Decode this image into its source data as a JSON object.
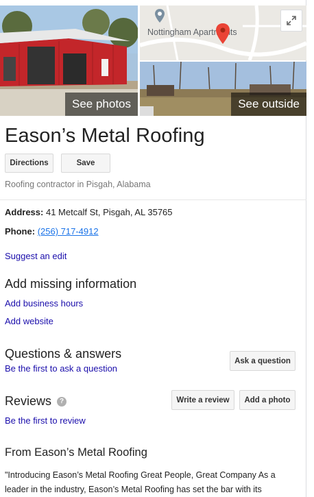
{
  "media": {
    "see_photos": "See photos",
    "see_outside": "See outside",
    "map_label": "Nottingham Apartments"
  },
  "business": {
    "name": "Eason’s Metal Roofing",
    "category": "Roofing contractor in Pisgah, Alabama"
  },
  "actions": {
    "directions": "Directions",
    "save": "Save"
  },
  "details": {
    "address_label": "Address:",
    "address": "41 Metcalf St, Pisgah, AL 35765",
    "phone_label": "Phone:",
    "phone": "(256) 717-4912"
  },
  "links": {
    "suggest_edit": "Suggest an edit",
    "add_hours": "Add business hours",
    "add_website": "Add website",
    "first_ask": "Be the first to ask a question",
    "first_review": "Be the first to review"
  },
  "sections": {
    "missing_info": "Add missing information",
    "qa": "Questions & answers",
    "reviews": "Reviews",
    "from": "From Eason’s Metal Roofing"
  },
  "buttons": {
    "ask_question": "Ask a question",
    "write_review": "Write a review",
    "add_photo": "Add a photo"
  },
  "description": "\"Introducing Eason’s Metal Roofing Great People, Great Company As a leader in the industry, Eason’s Metal Roofing has set the bar with its",
  "colors": {
    "link": "#1a0dab",
    "map_pin": "#ea4335"
  }
}
